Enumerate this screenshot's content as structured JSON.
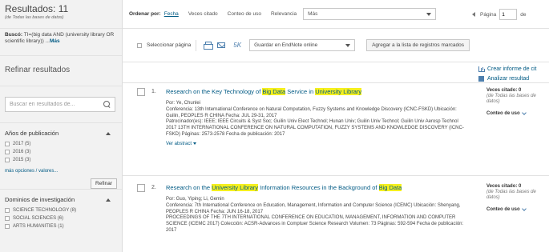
{
  "sidebar": {
    "results_title": "Resultados: 11",
    "results_sub": "(de Todas las bases de datos)",
    "search_label": "Buscó:",
    "search_query": "TI=(big data AND (university library OR scientific library)) ...",
    "search_more": "Más",
    "refine_title": "Refinar resultados",
    "refine_placeholder": "Buscar en resultados de...",
    "facet_years_title": "Años de publicación",
    "facet_years": [
      "2017 (5)",
      "2016 (3)",
      "2015 (3)"
    ],
    "more_options": "más opciones / valores...",
    "refine_button": "Refinar",
    "facet_domains_title": "Dominios de investigación",
    "facet_domains": [
      "SCIENCE TECHNOLOGY (8)",
      "SOCIAL SCIENCES (6)",
      "ARTS HUMANITIES (1)"
    ]
  },
  "sortbar": {
    "label": "Ordenar por:",
    "options": [
      "Fecha",
      "Veces citado",
      "Conteo de uso",
      "Relevancia"
    ],
    "more_select": "Más",
    "page_label": "Página",
    "page_value": "1",
    "page_suffix": "de"
  },
  "actionbar": {
    "select_page": "Seleccionar página",
    "k5": "5K",
    "endnote_select": "Guardar en EndNote online",
    "add_marked": "Agregar a la lista de registros marcados"
  },
  "right_links": {
    "citation_report": "Crear informe de cit",
    "analyze": "Analizar resultad"
  },
  "records": [
    {
      "num": "1.",
      "title_parts": [
        "Research on the Key Technology of ",
        "Big Data",
        " Service in ",
        "University Library"
      ],
      "authors": "Por: Ye, Chunlei",
      "conference": "Conferencia: 13th International Conference on Natural Computation, Fuzzy Systems and Knowledge Discovery (ICNC-FSKD) Ubicación: Guilin, PEOPLES R CHINA Fecha: JUL 29-31, 2017",
      "sponsors": "Patrocinador(es): IEEE; IEEE Circuits & Syst Soc; Guilin Univ Elect Technol; Hunan Univ; Guilin Univ Technol; Guilin Univ Aerosp Technol",
      "proceedings": "2017 13TH INTERNATIONAL CONFERENCE ON NATURAL COMPUTATION, FUZZY SYSTEMS AND KNOWLEDGE DISCOVERY (ICNC-FSKD)  Páginas: 2573-2578  Fecha de publicación: 2017",
      "abstract_link": "Ver abstract",
      "cites_label": "Veces citado: 0",
      "cites_sub": "(de Todas las bases de datos)",
      "usage": "Conteo de uso"
    },
    {
      "num": "2.",
      "title_parts": [
        "Research on the ",
        "University Library",
        " Information Resources in the Background of ",
        "Big Data"
      ],
      "authors": "Por: Guo, Yiping; Li, Gemin",
      "conference": "Conferencia: 7th International Conference on Education, Management, Information and Computer Science (ICEMC) Ubicación: Shenyang, PEOPLES R CHINA Fecha: JUN 16-18, 2017",
      "proceedings": "PROCEEDINGS OF THE 7TH INTERNATIONAL CONFERENCE ON EDUCATION, MANAGEMENT, INFORMATION AND COMPUTER SCIENCE (ICEMC 2017)  Colección: ACSR-Advances in Comptuer Science Research  Volumen: 73  Páginas: 592-594  Fecha de publicación: 2017",
      "cites_label": "Veces citado: 0",
      "cites_sub": "(de Todas las bases de datos)",
      "usage": "Conteo de uso"
    }
  ]
}
